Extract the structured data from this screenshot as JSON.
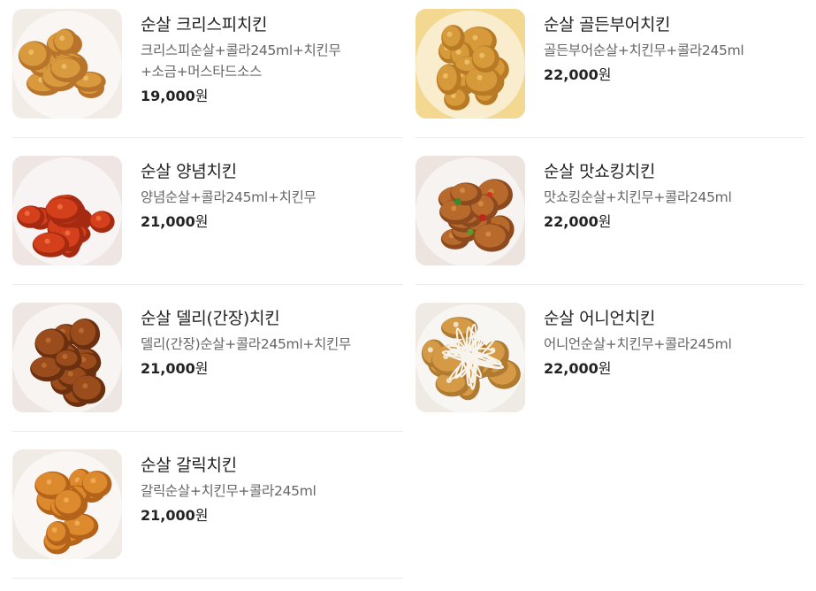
{
  "currency_suffix": "원",
  "menu": [
    {
      "name": "순살 크리스피치킨",
      "desc_lines": [
        "크리스피순살+콜라245ml+치킨무",
        "+소금+머스타드소스"
      ],
      "price": "19,000",
      "image": "crispy-chicken-image",
      "colors": {
        "bg": "#f2ece6",
        "food": "#d99a3e",
        "dark": "#b8742a",
        "light": "#f0c06a"
      }
    },
    {
      "name": "순살 골든부어치킨",
      "desc_lines": [
        "골든부어순살+치킨무+콜라245ml"
      ],
      "price": "22,000",
      "image": "golden-chicken-image",
      "colors": {
        "bg": "#f2d890",
        "food": "#d69a3a",
        "dark": "#b97a26",
        "light": "#f0c46a"
      }
    },
    {
      "name": "순살 양념치킨",
      "desc_lines": [
        "양념순살+콜라245ml+치킨무"
      ],
      "price": "21,000",
      "image": "yangnyeom-chicken-image",
      "colors": {
        "bg": "#efe6e4",
        "food": "#d5401c",
        "dark": "#a52a12",
        "light": "#ef7444"
      }
    },
    {
      "name": "순살 맛쇼킹치킨",
      "desc_lines": [
        "맛쇼킹순살+치킨무+콜라245ml"
      ],
      "price": "22,000",
      "image": "mat-shocking-chicken-image",
      "colors": {
        "bg": "#ede4e0",
        "food": "#b86a2c",
        "dark": "#8c4a1e",
        "light": "#d89048"
      }
    },
    {
      "name": "순살 델리(간장)치킨",
      "desc_lines": [
        "델리(간장)순살+콜라245ml+치킨무"
      ],
      "price": "21,000",
      "image": "deli-soy-chicken-image",
      "colors": {
        "bg": "#eee6e2",
        "food": "#9a4c1c",
        "dark": "#6a3010",
        "light": "#c07030"
      }
    },
    {
      "name": "순살 어니언치킨",
      "desc_lines": [
        "어니언순살+치킨무+콜라245ml"
      ],
      "price": "22,000",
      "image": "onion-chicken-image",
      "colors": {
        "bg": "#f0eae4",
        "food": "#d49a46",
        "dark": "#b07a30",
        "light": "#f4f0e6"
      }
    },
    {
      "name": "순살 갈릭치킨",
      "desc_lines": [
        "갈릭순살+치킨무+콜라245ml"
      ],
      "price": "21,000",
      "image": "garlic-chicken-image",
      "colors": {
        "bg": "#f1ebe6",
        "food": "#dd8a2e",
        "dark": "#b4631a",
        "light": "#f2b05a"
      }
    }
  ]
}
